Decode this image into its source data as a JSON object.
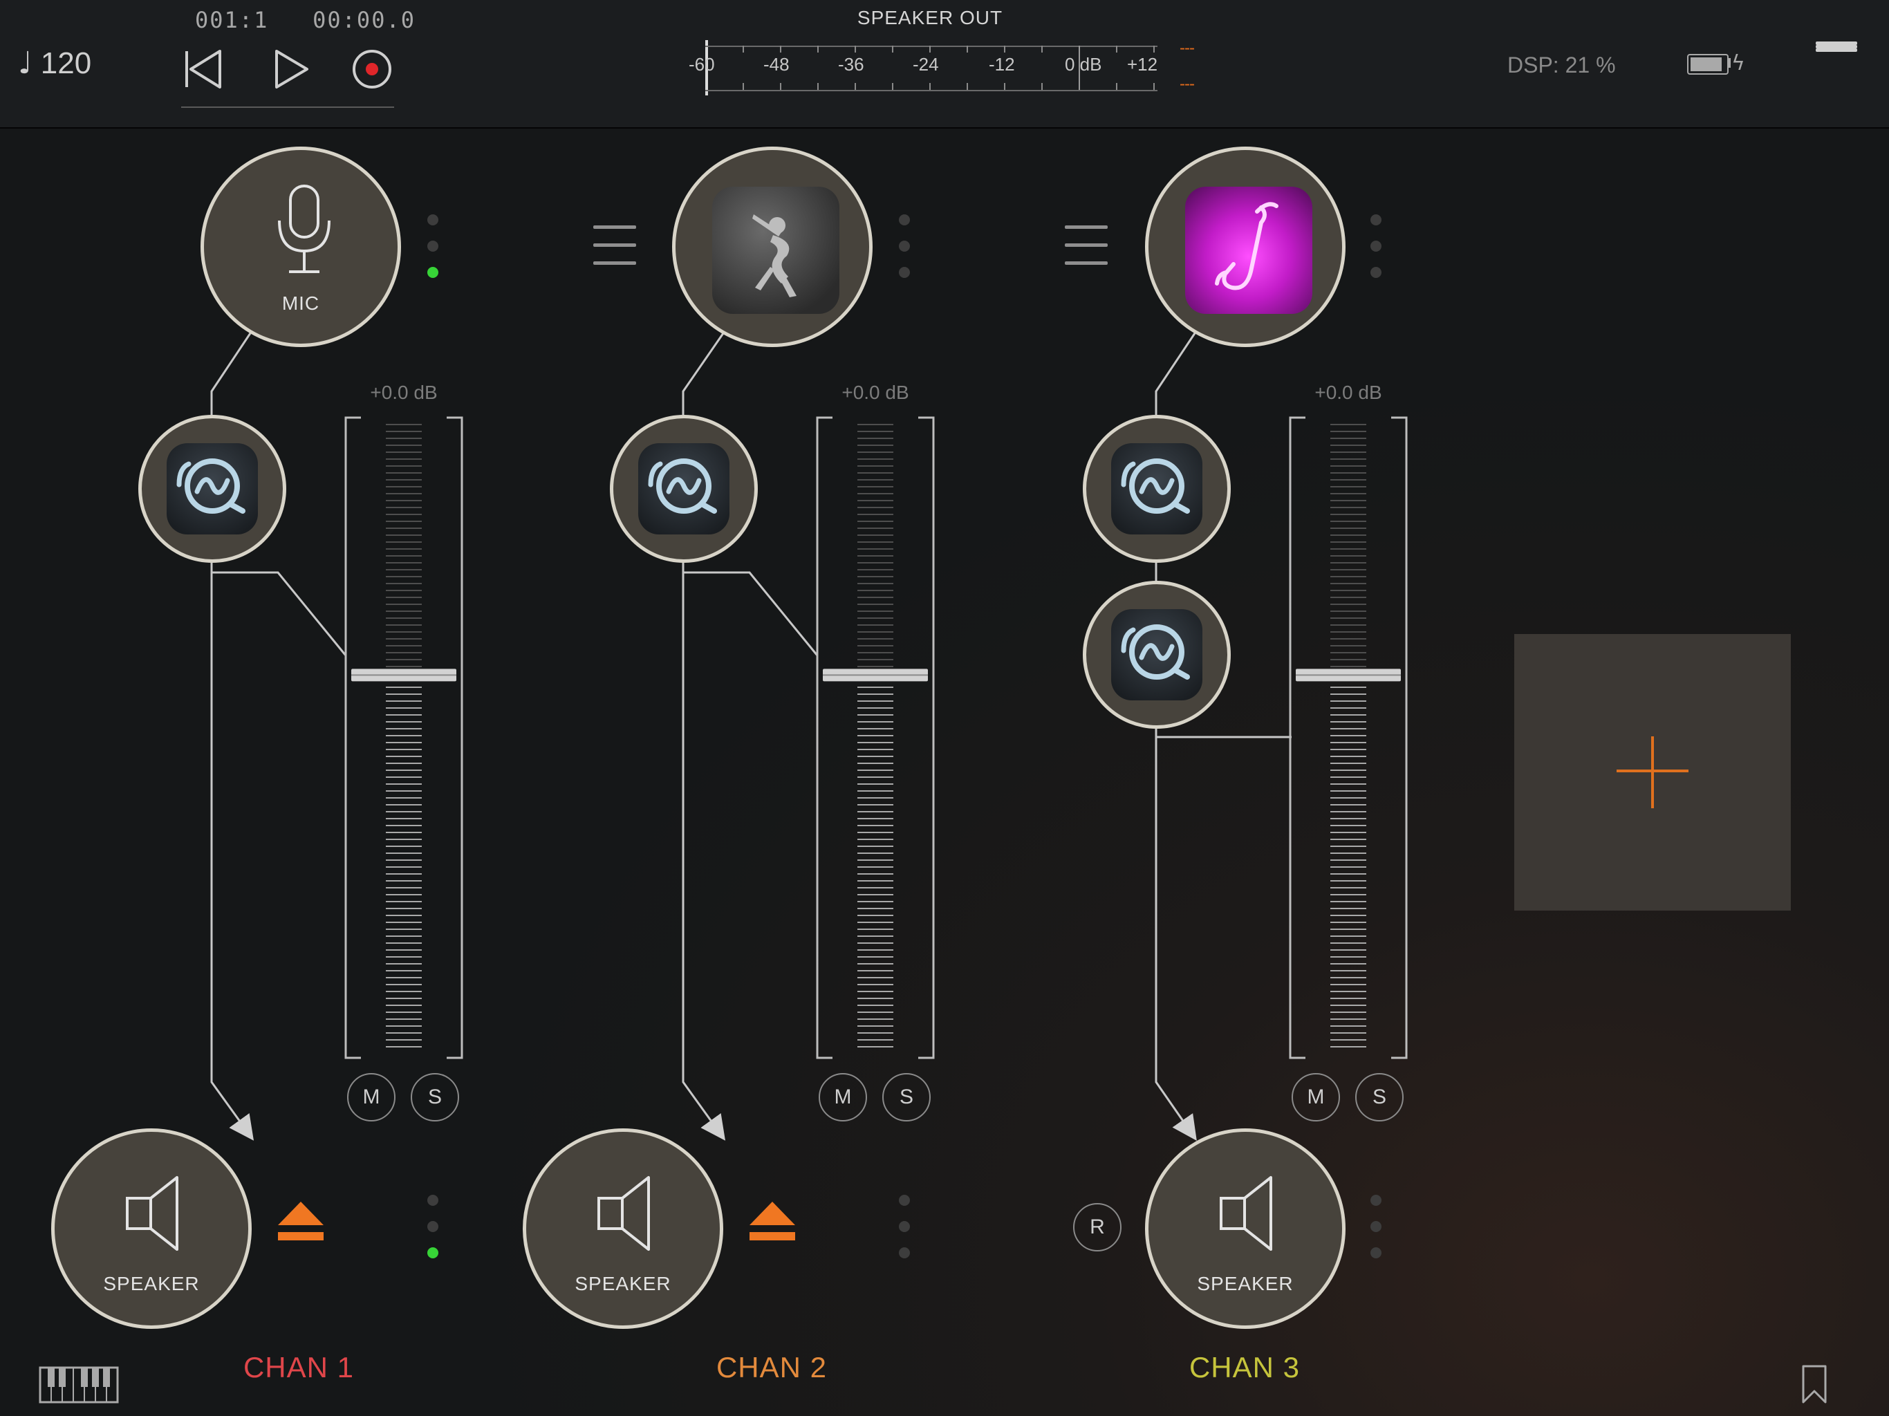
{
  "header": {
    "tempo": "120",
    "tempo_icon": "quarter-note-icon",
    "position": "001:1",
    "time": "00:00.0",
    "meter": {
      "title": "SPEAKER OUT",
      "scale": [
        "-60",
        "-48",
        "-36",
        "-24",
        "-12",
        "0 dB",
        "+12"
      ],
      "peak_left": "---",
      "peak_right": "---"
    },
    "dsp": "DSP: 21 %",
    "battery_level": 0.9
  },
  "channels": [
    {
      "name": "CHAN 1",
      "color": "#e0464a",
      "source": {
        "label": "MIC",
        "icon": "microphone-icon"
      },
      "effects": [
        "eq-icon"
      ],
      "gain": "+0.0 dB",
      "fader_level": 0.6,
      "mute": "M",
      "solo": "S",
      "output": {
        "label": "SPEAKER",
        "icon": "speaker-icon"
      },
      "indicator_active": true,
      "eject_color": "#f07722"
    },
    {
      "name": "CHAN 2",
      "color": "#e38a3c",
      "source": {
        "label": "",
        "icon": "flute-player-app-icon"
      },
      "effects": [
        "eq-icon"
      ],
      "gain": "+0.0 dB",
      "fader_level": 0.6,
      "mute": "M",
      "solo": "S",
      "output": {
        "label": "SPEAKER",
        "icon": "speaker-icon"
      },
      "indicator_active": false,
      "eject_color": "#f07722"
    },
    {
      "name": "CHAN 3",
      "color": "#c6c43c",
      "source": {
        "label": "",
        "icon": "saxophone-app-icon"
      },
      "effects": [
        "eq-icon",
        "eq-icon"
      ],
      "gain": "+0.0 dB",
      "fader_level": 0.6,
      "mute": "M",
      "solo": "S",
      "record": "R",
      "output": {
        "label": "SPEAKER",
        "icon": "speaker-icon"
      },
      "indicator_active": false
    }
  ],
  "footer": {
    "keyboard_icon": "piano-keyboard-icon",
    "bookmark_icon": "bookmark-icon"
  },
  "add_channel_icon": "plus-icon"
}
